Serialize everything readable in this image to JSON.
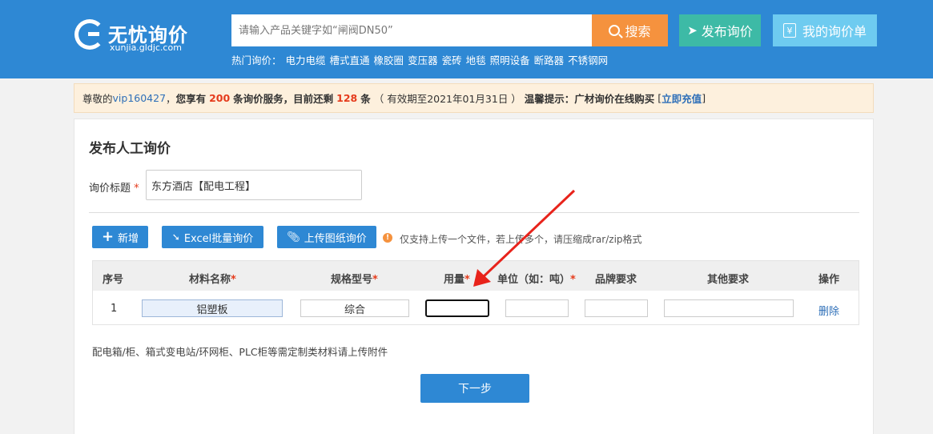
{
  "header": {
    "logo_title": "无忧询价",
    "logo_sub": "xunjia.gldjc.com",
    "search_placeholder": "请输入产品关键字如“闸阀DN50”",
    "search_button": "搜索",
    "publish_button": "发布询价",
    "my_orders_button": "我的询价单",
    "hot_label": "热门询价：",
    "hot_words": [
      "电力电缆",
      "槽式直通",
      "橡胶圈",
      "变压器",
      "瓷砖",
      "地毯",
      "照明设备",
      "断路器",
      "不锈钢网"
    ],
    "icons": {
      "search": "search-icon",
      "publish": "paper-plane-icon",
      "orders": "yen-receipt-icon"
    },
    "colors": {
      "bar": "#2e88d4",
      "search": "#f5923e",
      "publish": "#3dbaa6",
      "orders": "#6ecbf0"
    }
  },
  "notice": {
    "prefix": "尊敬的",
    "user": "vip160427",
    "sep": "，",
    "text1": "您享有",
    "total": "200",
    "text2": "条询价服务，目前还剩",
    "remaining": "128",
    "text3": "条",
    "validity": "（ 有效期至2021年01月31日 ）",
    "tip": "温馨提示：广材询价在线购买",
    "link_open": "[",
    "link": "立即充值",
    "link_close": "]"
  },
  "form": {
    "title": "发布人工询价",
    "title_label": "询价标题",
    "required_mark": "*",
    "title_value": "东方酒店【配电工程】",
    "add_button": "新增",
    "excel_button": "Excel批量询价",
    "upload_button": "上传图纸询价",
    "info_glyph": "!",
    "upload_hint": "仅支持上传一个文件，若上传多个，请压缩成rar/zip格式",
    "columns": {
      "index": "序号",
      "material": "材料名称",
      "spec": "规格型号",
      "qty": "用量",
      "unit": "单位（如：吨）",
      "brand": "品牌要求",
      "other": "其他要求",
      "action": "操作"
    },
    "rows": [
      {
        "index": "1",
        "material": "铝塑板",
        "spec": "综合",
        "qty": "",
        "unit": "",
        "brand": "",
        "other": "",
        "action": "删除"
      }
    ],
    "footnote": "配电箱/柜、箱式变电站/环网柜、PLC柜等需定制类材料请上传附件",
    "next_button": "下一步"
  }
}
